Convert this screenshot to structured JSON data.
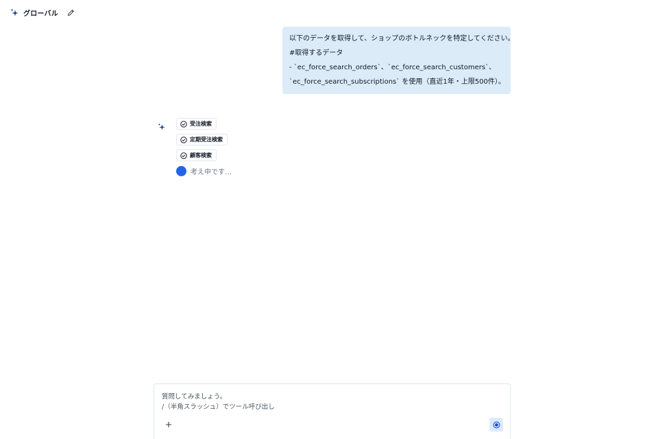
{
  "header": {
    "title": "グローバル"
  },
  "conversation": {
    "user_message": {
      "lines": [
        "以下のデータを取得して、ショップのボトルネックを特定してください。",
        "#取得するデータ",
        "- `ec_force_search_orders`、`ec_force_search_customers`、",
        "`ec_force_search_subscriptions` を使用（直近1年・上限500件）。"
      ]
    },
    "assistant": {
      "tools": [
        {
          "label": "受注検索"
        },
        {
          "label": "定期受注検索"
        },
        {
          "label": "顧客検索"
        }
      ],
      "thinking_text": "考え中です…"
    }
  },
  "composer": {
    "placeholder_line1": "質問してみましょう。",
    "placeholder_line2": "/（半角スラッシュ）でツール呼び出し"
  },
  "colors": {
    "accent": "#2563eb",
    "bubble_bg": "#dcebf8",
    "send_bg": "#dbeafe"
  },
  "icons": {
    "header": "sparkle-icon",
    "edit": "pencil-icon",
    "assistant": "sparkle-icon",
    "tool_status": "check-circle-icon",
    "add": "plus-icon",
    "send": "record-icon"
  }
}
